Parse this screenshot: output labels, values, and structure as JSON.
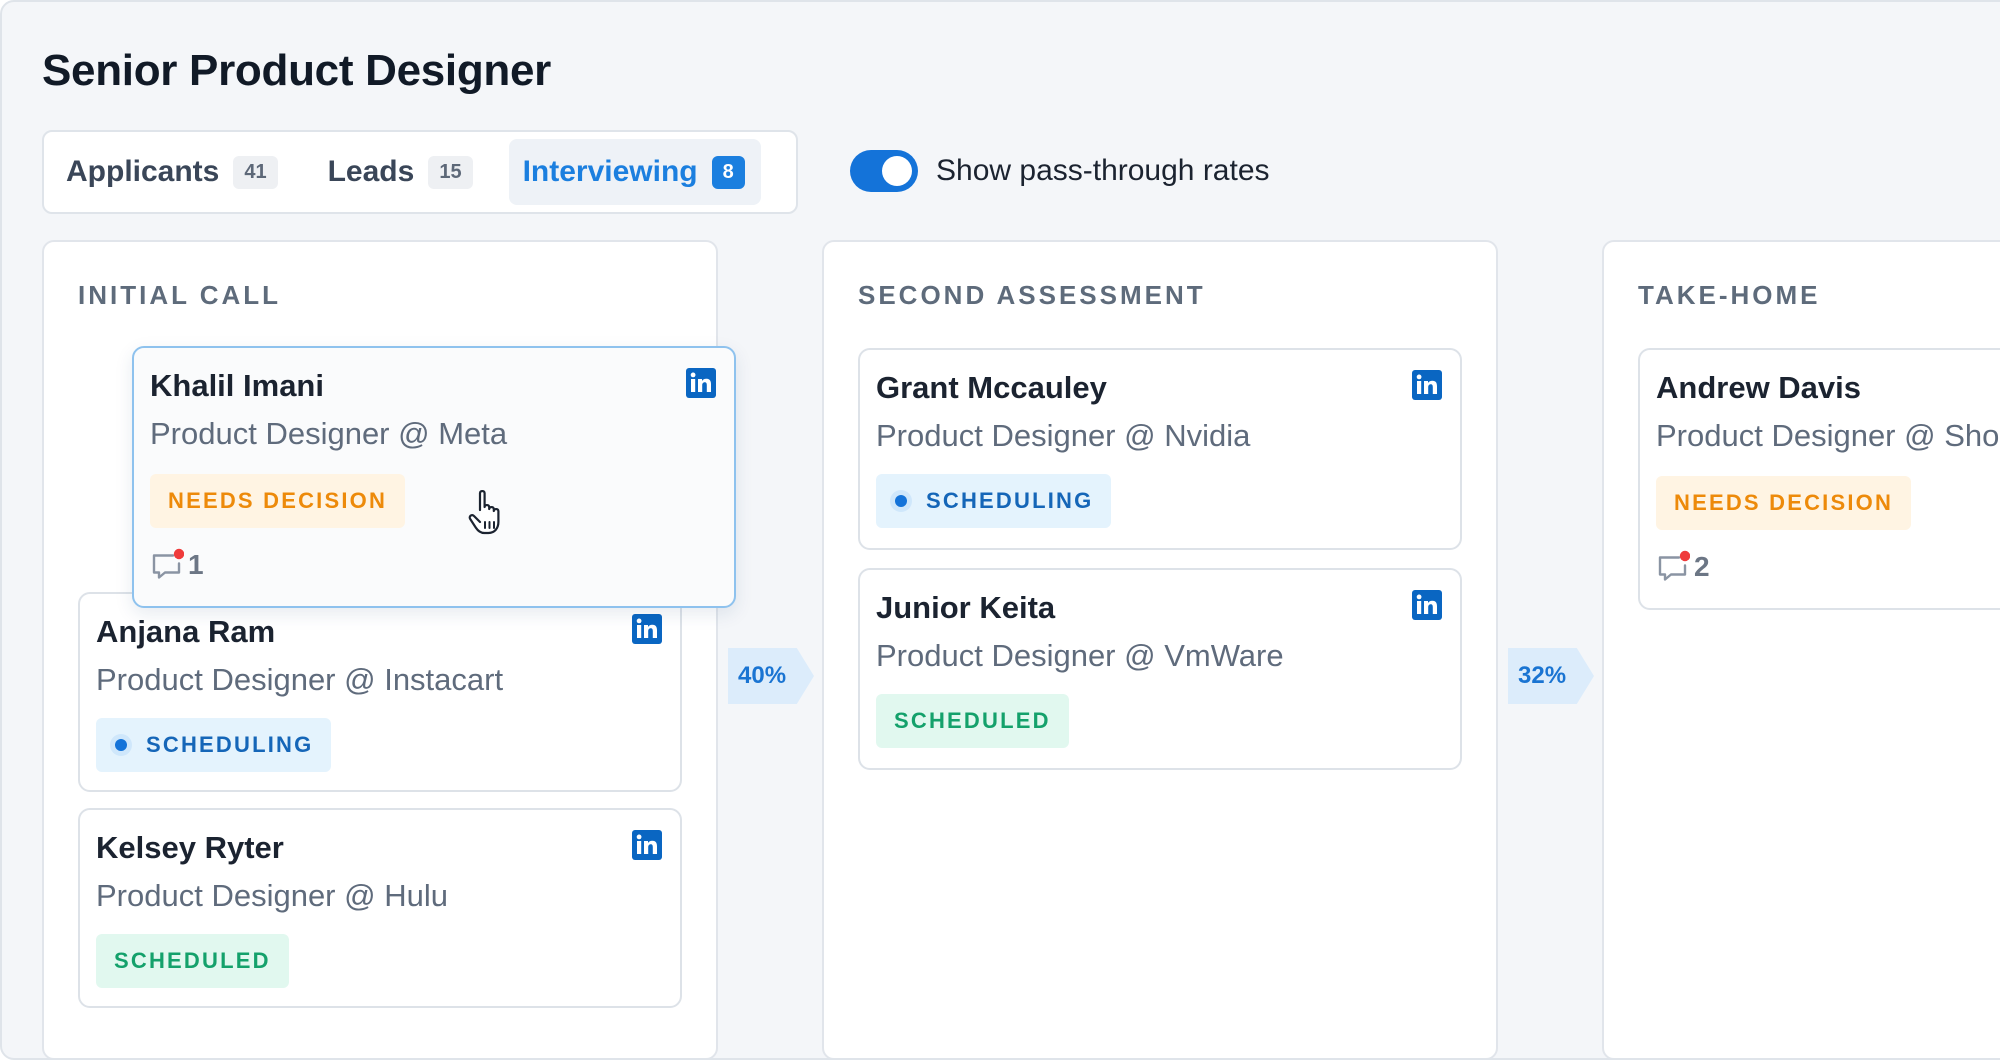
{
  "page_title": "Senior Product Designer",
  "tabs": [
    {
      "label": "Applicants",
      "count": "41"
    },
    {
      "label": "Leads",
      "count": "15"
    },
    {
      "label": "Interviewing",
      "count": "8"
    }
  ],
  "toggle": {
    "label": "Show pass-through rates",
    "on": true
  },
  "columns": [
    {
      "title": "INITIAL CALL",
      "cards": [
        {
          "name": "Khalil Imani",
          "role": "Product Designer @ Meta",
          "status": "NEEDS DECISION",
          "comments": "1"
        },
        {
          "name": "Anjana Ram",
          "role": "Product Designer @ Instacart",
          "status": "SCHEDULING"
        },
        {
          "name": "Kelsey Ryter",
          "role": "Product Designer @ Hulu",
          "status": "SCHEDULED"
        }
      ]
    },
    {
      "title": "SECOND ASSESSMENT",
      "cards": [
        {
          "name": "Grant Mccauley",
          "role": "Product Designer @ Nvidia",
          "status": "SCHEDULING"
        },
        {
          "name": "Junior Keita",
          "role": "Product Designer @ VmWare",
          "status": "SCHEDULED"
        }
      ]
    },
    {
      "title": "TAKE-HOME",
      "cards": [
        {
          "name": "Andrew Davis",
          "role": "Product Designer @ Shopify",
          "status": "NEEDS DECISION",
          "comments": "2"
        }
      ]
    }
  ],
  "pass_through_rates": [
    "40%",
    "32%"
  ],
  "icons": {
    "profile": "linkedin-icon",
    "comment": "comment-icon",
    "cursor": "hand-cursor-icon"
  },
  "colors": {
    "accent": "#1b7fdf",
    "needs_decision": "#ed8a0a",
    "scheduling": "#1566b8",
    "scheduled": "#14a16b",
    "unread_dot": "#ef3b3b"
  }
}
